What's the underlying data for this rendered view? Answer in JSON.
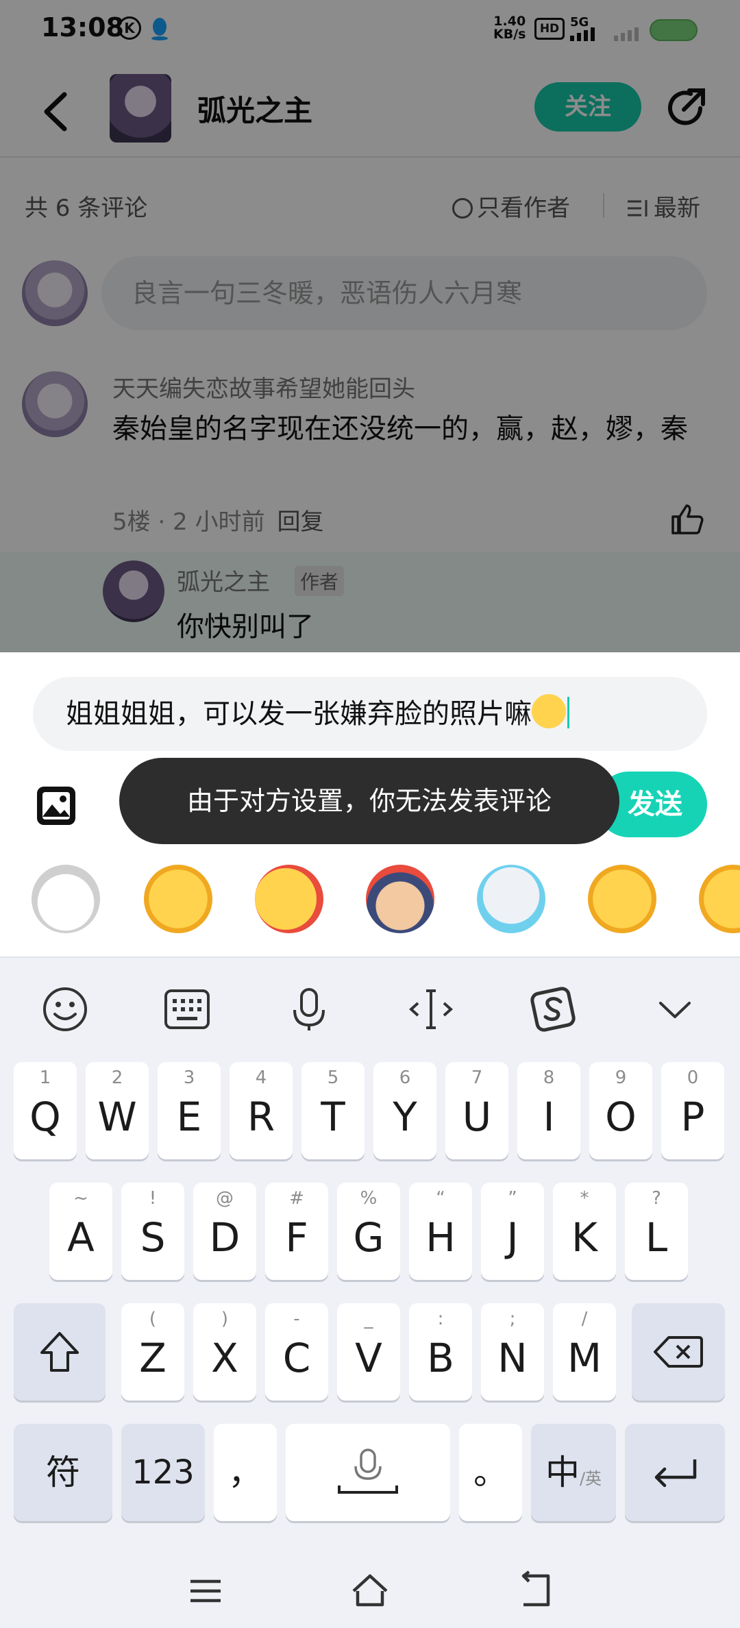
{
  "status_bar": {
    "time": "13:08",
    "speed": "1.40",
    "speed_unit": "KB/s",
    "network": "5G",
    "hd": "HD"
  },
  "header": {
    "title": "弧光之主",
    "follow_label": "关注"
  },
  "sort_bar": {
    "count": "共 6 条评论",
    "author_only": "只看作者",
    "sort": "最新"
  },
  "comment_input": {
    "placeholder": "良言一句三冬暖，恶语伤人六月寒"
  },
  "comment": {
    "user": "天天编失恋故事希望她能回头",
    "text": "秦始皇的名字现在还没统一的，赢，赵，嫪，秦",
    "meta": "5楼 · 2 小时前",
    "reply_label": "回复"
  },
  "reply": {
    "user": "弧光之主",
    "tag": "作者",
    "text": "你快别叫了"
  },
  "composer": {
    "text": "姐姐姐姐，可以发一张嫌弃脸的照片嘛",
    "send_label": "发送",
    "toast": "由于对方设置，你无法发表评论"
  },
  "stickers": [
    "dog-sticker",
    "crying-sticker",
    "flower-sticker",
    "heart-hand-sticker",
    "seal-sticker",
    "drool-sticker",
    "laugh-sticker"
  ],
  "keyboard": {
    "row1": [
      {
        "hint": "1",
        "key": "Q"
      },
      {
        "hint": "2",
        "key": "W"
      },
      {
        "hint": "3",
        "key": "E"
      },
      {
        "hint": "4",
        "key": "R"
      },
      {
        "hint": "5",
        "key": "T"
      },
      {
        "hint": "6",
        "key": "Y"
      },
      {
        "hint": "7",
        "key": "U"
      },
      {
        "hint": "8",
        "key": "I"
      },
      {
        "hint": "9",
        "key": "O"
      },
      {
        "hint": "0",
        "key": "P"
      }
    ],
    "row2": [
      {
        "hint": "~",
        "key": "A"
      },
      {
        "hint": "!",
        "key": "S"
      },
      {
        "hint": "@",
        "key": "D"
      },
      {
        "hint": "#",
        "key": "F"
      },
      {
        "hint": "%",
        "key": "G"
      },
      {
        "hint": "“",
        "key": "H"
      },
      {
        "hint": "”",
        "key": "J"
      },
      {
        "hint": "*",
        "key": "K"
      },
      {
        "hint": "?",
        "key": "L"
      }
    ],
    "row3": [
      {
        "hint": "(",
        "key": "Z"
      },
      {
        "hint": ")",
        "key": "X"
      },
      {
        "hint": "-",
        "key": "C"
      },
      {
        "hint": "_",
        "key": "V"
      },
      {
        "hint": ":",
        "key": "B"
      },
      {
        "hint": ";",
        "key": "N"
      },
      {
        "hint": "/",
        "key": "M"
      }
    ],
    "symbols_label": "符",
    "numbers_label": "123",
    "comma_label": "，",
    "period_label": "。",
    "lang_label": "中",
    "lang_sub": "/英"
  },
  "colors": {
    "accent": "#16c9a8",
    "send": "#16d3b6",
    "toast_bg": "#2d2d2d",
    "keyboard_bg": "#eff1f6"
  }
}
